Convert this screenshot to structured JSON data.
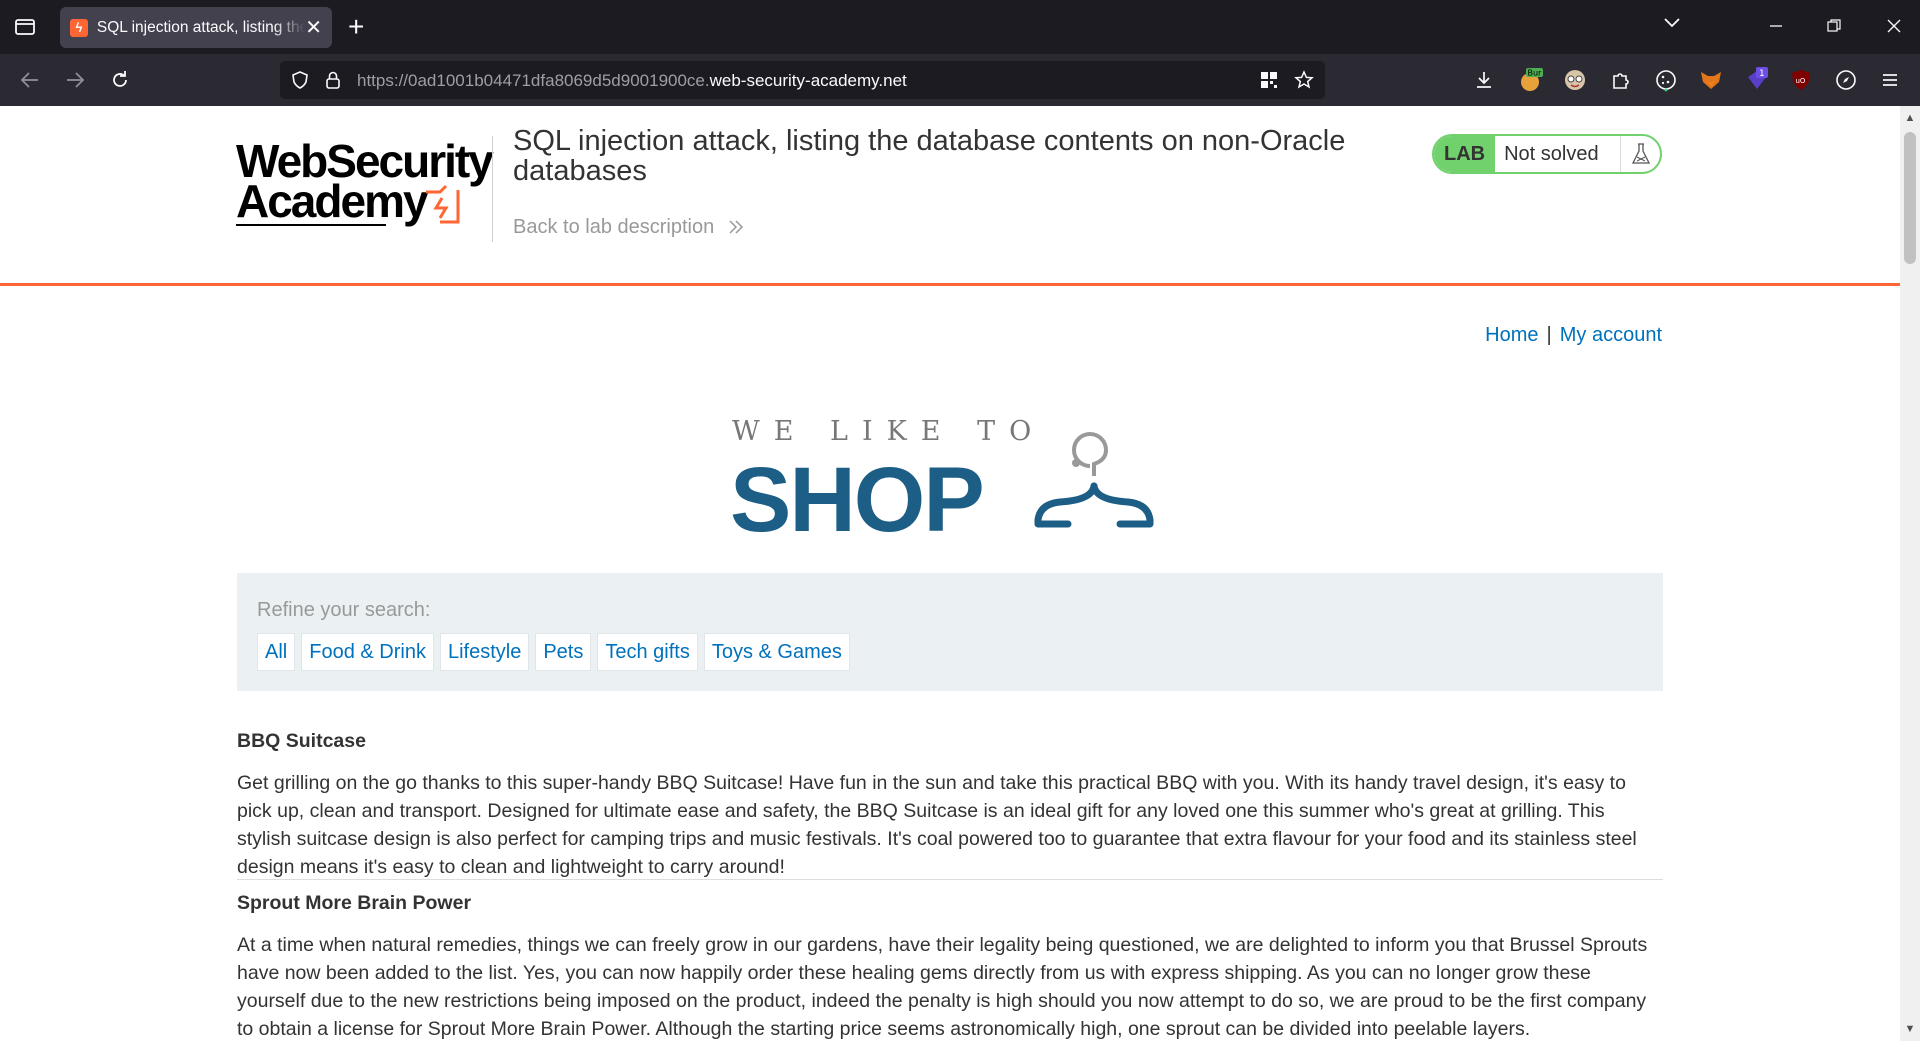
{
  "browser": {
    "tab_title": "SQL injection attack, listing the database contents on non-Oracle databases",
    "url_prefix": "https://0ad1001b04471dfa8069d5d9001900ce.",
    "url_domain": "web-security-academy.net",
    "extensions": [
      "download-icon",
      "burp-extension-icon",
      "face-extension-icon",
      "puzzle-icon",
      "cookie-icon",
      "fox-extension-icon",
      "badge-extension-icon",
      "ublock-icon",
      "compass-icon",
      "menu-icon"
    ],
    "ext_badge": "1"
  },
  "lab": {
    "logo_line1": "WebSecurity",
    "logo_line2": "Academy",
    "title": "SQL injection attack, listing the database contents on non-Oracle databases",
    "back_link": "Back to lab description",
    "status_label": "LAB",
    "status_value": "Not solved",
    "accent_color": "#ff6633",
    "status_color": "#70d16d"
  },
  "nav": {
    "home": "Home",
    "separator": "|",
    "account": "My account",
    "link_color": "#0071bc"
  },
  "shop_logo": {
    "line1": "WE LIKE TO",
    "line2": "SHOP",
    "color": "#1d5e86"
  },
  "search": {
    "refine_label": "Refine your search:",
    "filters": [
      "All",
      "Food & Drink",
      "Lifestyle",
      "Pets",
      "Tech gifts",
      "Toys & Games"
    ]
  },
  "products": [
    {
      "name": "BBQ Suitcase",
      "description": "Get grilling on the go thanks to this super-handy BBQ Suitcase! Have fun in the sun and take this practical BBQ with you. With its handy travel design, it's easy to pick up, clean and transport. Designed for ultimate ease and safety, the BBQ Suitcase is an ideal gift for any loved one this summer who's great at grilling. This stylish suitcase design is also perfect for camping trips and music festivals. It's coal powered too to guarantee that extra flavour for your food and its stainless steel design means it's easy to clean and lightweight to carry around!"
    },
    {
      "name": "Sprout More Brain Power",
      "description": "At a time when natural remedies, things we can freely grow in our gardens, have their legality being questioned, we are delighted to inform you that Brussel Sprouts have now been added to the list. Yes, you can now happily order these healing gems directly from us with express shipping. As you can no longer grow these yourself due to the new restrictions being imposed on the product, indeed the penalty is high should you now attempt to do so, we are proud to be the first company to obtain a license for Sprout More Brain Power. Although the starting price seems astronomically high, one sprout can be divided into peelable layers."
    }
  ]
}
